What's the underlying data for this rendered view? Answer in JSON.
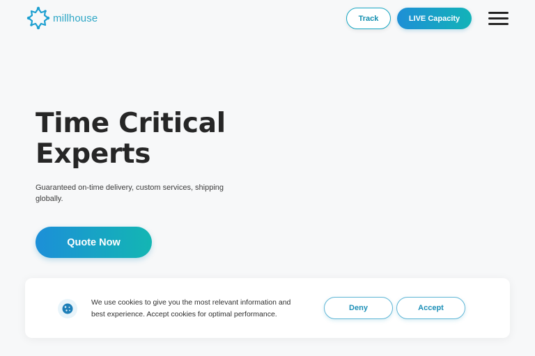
{
  "brand": {
    "name": "millhouse",
    "logo_icon": "flower-logo-icon",
    "colors": {
      "accent": "#15a6c2",
      "gradient_start": "#1c8fd8",
      "gradient_end": "#13b6b3",
      "text": "#262626"
    }
  },
  "header": {
    "track_label": "Track",
    "live_capacity_label": "LIVE Capacity",
    "menu_icon": "hamburger-menu-icon"
  },
  "hero": {
    "title_line1": "Time Critical",
    "title_line2": "Experts",
    "subtitle": "Guaranteed on-time delivery, custom services, shipping globally.",
    "cta_label": "Quote Now"
  },
  "cookie_banner": {
    "icon": "cookie-icon",
    "text": "We use cookies to give you the most relevant information and best experience. Accept cookies for optimal performance.",
    "deny_label": "Deny",
    "accept_label": "Accept"
  }
}
